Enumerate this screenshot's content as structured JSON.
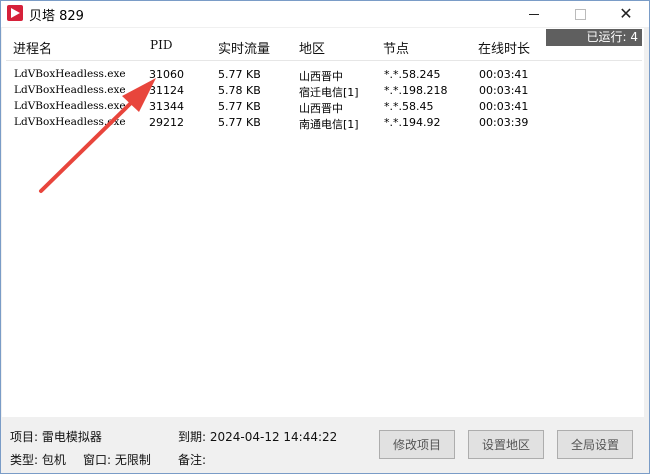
{
  "window": {
    "title": "贝塔 829"
  },
  "badge": {
    "running": "已运行: 4"
  },
  "table": {
    "headers": [
      "进程名",
      "PID",
      "实时流量",
      "地区",
      "节点",
      "在线时长"
    ],
    "rows": [
      [
        "LdVBoxHeadless.exe",
        "31060",
        "5.77 KB",
        "山西晋中",
        "*.*.58.245",
        "00:03:41"
      ],
      [
        "LdVBoxHeadless.exe",
        "31124",
        "5.78 KB",
        "宿迁电信[1]",
        "*.*.198.218",
        "00:03:41"
      ],
      [
        "LdVBoxHeadless.exe",
        "31344",
        "5.77 KB",
        "山西晋中",
        "*.*.58.45",
        "00:03:41"
      ],
      [
        "LdVBoxHeadless.exe",
        "29212",
        "5.77 KB",
        "南通电信[1]",
        "*.*.194.92",
        "00:03:39"
      ]
    ]
  },
  "info": {
    "project": "项目: 雷电模拟器",
    "expire": "到期: 2024-04-12 14:44:22",
    "type": "类型: 包机",
    "window_limit": "窗口: 无限制",
    "note": "备注:"
  },
  "buttons": {
    "edit_project": "修改项目",
    "set_region": "设置地区",
    "global_settings": "全局设置"
  },
  "colors": {
    "arrow": "#e8453c",
    "app_icon": "#d6213a",
    "badge_bg": "#5f5f5f"
  },
  "icons": {
    "app": "beta-app-icon",
    "annotation": "red-arrow-annotation"
  }
}
